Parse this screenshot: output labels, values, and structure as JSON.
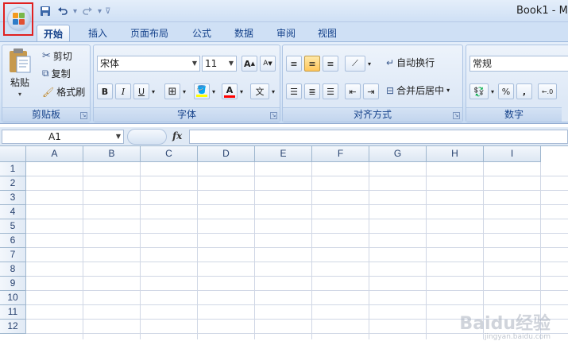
{
  "titlebar": {
    "title": "Book1 - M",
    "qat": {
      "save_icon": "save-icon",
      "undo_icon": "undo-icon",
      "redo_icon": "redo-icon",
      "customize_icon": "customize-qat-icon"
    }
  },
  "tabs": [
    "开始",
    "插入",
    "页面布局",
    "公式",
    "数据",
    "审阅",
    "视图"
  ],
  "ribbon": {
    "clipboard": {
      "label": "剪贴板",
      "paste": "粘贴",
      "cut": "剪切",
      "copy": "复制",
      "format_painter": "格式刷"
    },
    "font": {
      "label": "字体",
      "font_name": "宋体",
      "font_size": "11",
      "bold": "B",
      "italic": "I",
      "underline": "U",
      "font_color_symbol": "A",
      "phonetic": "文",
      "grow_symbol": "A",
      "shrink_symbol": "A"
    },
    "alignment": {
      "label": "对齐方式",
      "wrap_text": "自动换行",
      "merge_center": "合并后居中"
    },
    "number": {
      "label": "数字",
      "format": "常规",
      "percent": "%",
      "comma": ","
    }
  },
  "formula_bar": {
    "name_box": "A1",
    "fx": "fx",
    "formula": ""
  },
  "sheet": {
    "columns": [
      "A",
      "B",
      "C",
      "D",
      "E",
      "F",
      "G",
      "H",
      "I"
    ],
    "rows": [
      "1",
      "2",
      "3",
      "4",
      "5",
      "6",
      "7",
      "8",
      "9",
      "10",
      "11",
      "12"
    ]
  },
  "watermark": {
    "text": "Baidu经验",
    "sub": "jingyan.baidu.com"
  },
  "colors": {
    "highlight_box": "#e02020",
    "accent": "#15428b",
    "fill_yellow": "#ffff00",
    "font_red": "#ff0000"
  }
}
